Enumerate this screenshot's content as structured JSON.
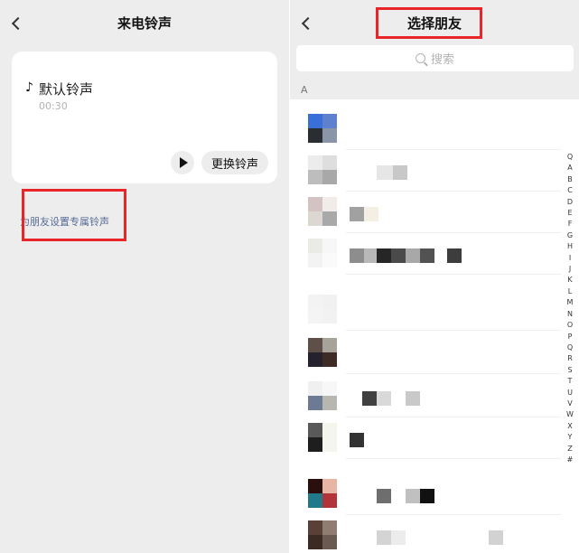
{
  "left": {
    "title": "来电铃声",
    "ringtone": {
      "note": "♪",
      "name": "默认铃声",
      "duration": "00:30"
    },
    "change_label": "更换铃声",
    "friend_link": "为朋友设置专属铃声"
  },
  "right": {
    "title": "选择朋友",
    "search_placeholder": "搜索",
    "section_letter": "A",
    "index": [
      "Q",
      "A",
      "B",
      "C",
      "D",
      "E",
      "F",
      "G",
      "H",
      "I",
      "J",
      "K",
      "L",
      "M",
      "N",
      "O",
      "P",
      "Q",
      "R",
      "S",
      "T",
      "U",
      "V",
      "W",
      "X",
      "Y",
      "Z",
      "#"
    ]
  },
  "colors": {
    "highlight_red": "#e8262a",
    "link_blue": "#576b95",
    "background": "#ededed"
  }
}
